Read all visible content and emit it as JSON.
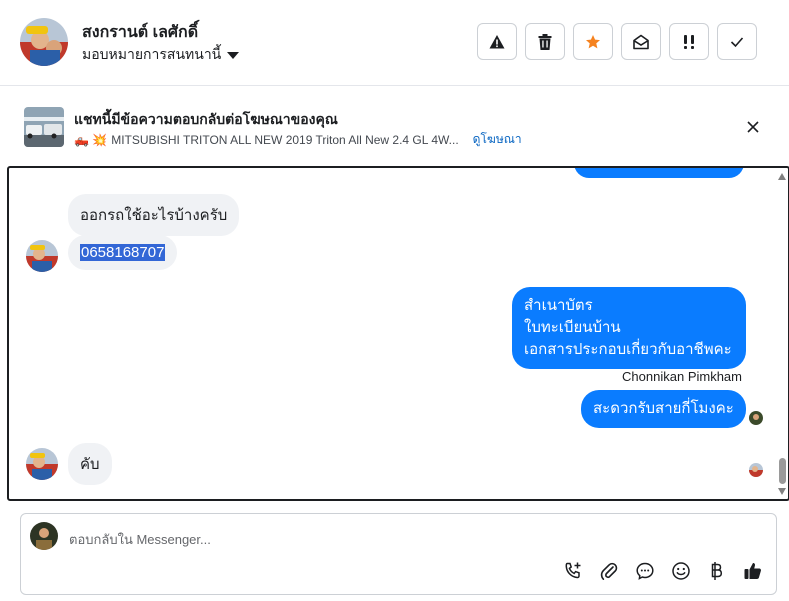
{
  "header": {
    "name": "สงกรานต์ เลศักดิ์",
    "assign_label": "มอบหมายการสนทนานี้",
    "toolbar": [
      "warning-icon",
      "trash-icon",
      "star-icon",
      "envelope-open-icon",
      "priority-icon",
      "check-icon"
    ]
  },
  "ad": {
    "title": "แชทนี้มีข้อความตอบกลับต่อโฆษณาของคุณ",
    "subtitle": "MITSUBISHI TRITON ALL NEW 2019 Triton All New 2.4 GL 4W...",
    "emoji": "🛻 💥",
    "link": "ดูโฆษณา"
  },
  "messages": {
    "m1": "ออกรถใช้อะไรบ้างครับ",
    "m2": "0658168707",
    "m3_lines": [
      "สำเนาบัตร",
      "ใบทะเบียนบ้าน",
      "เอกสารประกอบเกี่ยวกับอาชีพคะ"
    ],
    "sender_name": "Chonnikan Pimkham",
    "m4": "สะดวกรับสายกี่โมงคะ",
    "m5": "คับ"
  },
  "composer": {
    "placeholder": "ตอบกลับใน Messenger...",
    "icons": [
      "call-add-icon",
      "attachment-icon",
      "saved-reply-icon",
      "emoji-icon",
      "baht-icon",
      "like-icon"
    ]
  },
  "colors": {
    "outgoing": "#0a7cff",
    "incoming": "#f0f2f5",
    "star": "#f5821f",
    "link": "#0a66c2"
  }
}
